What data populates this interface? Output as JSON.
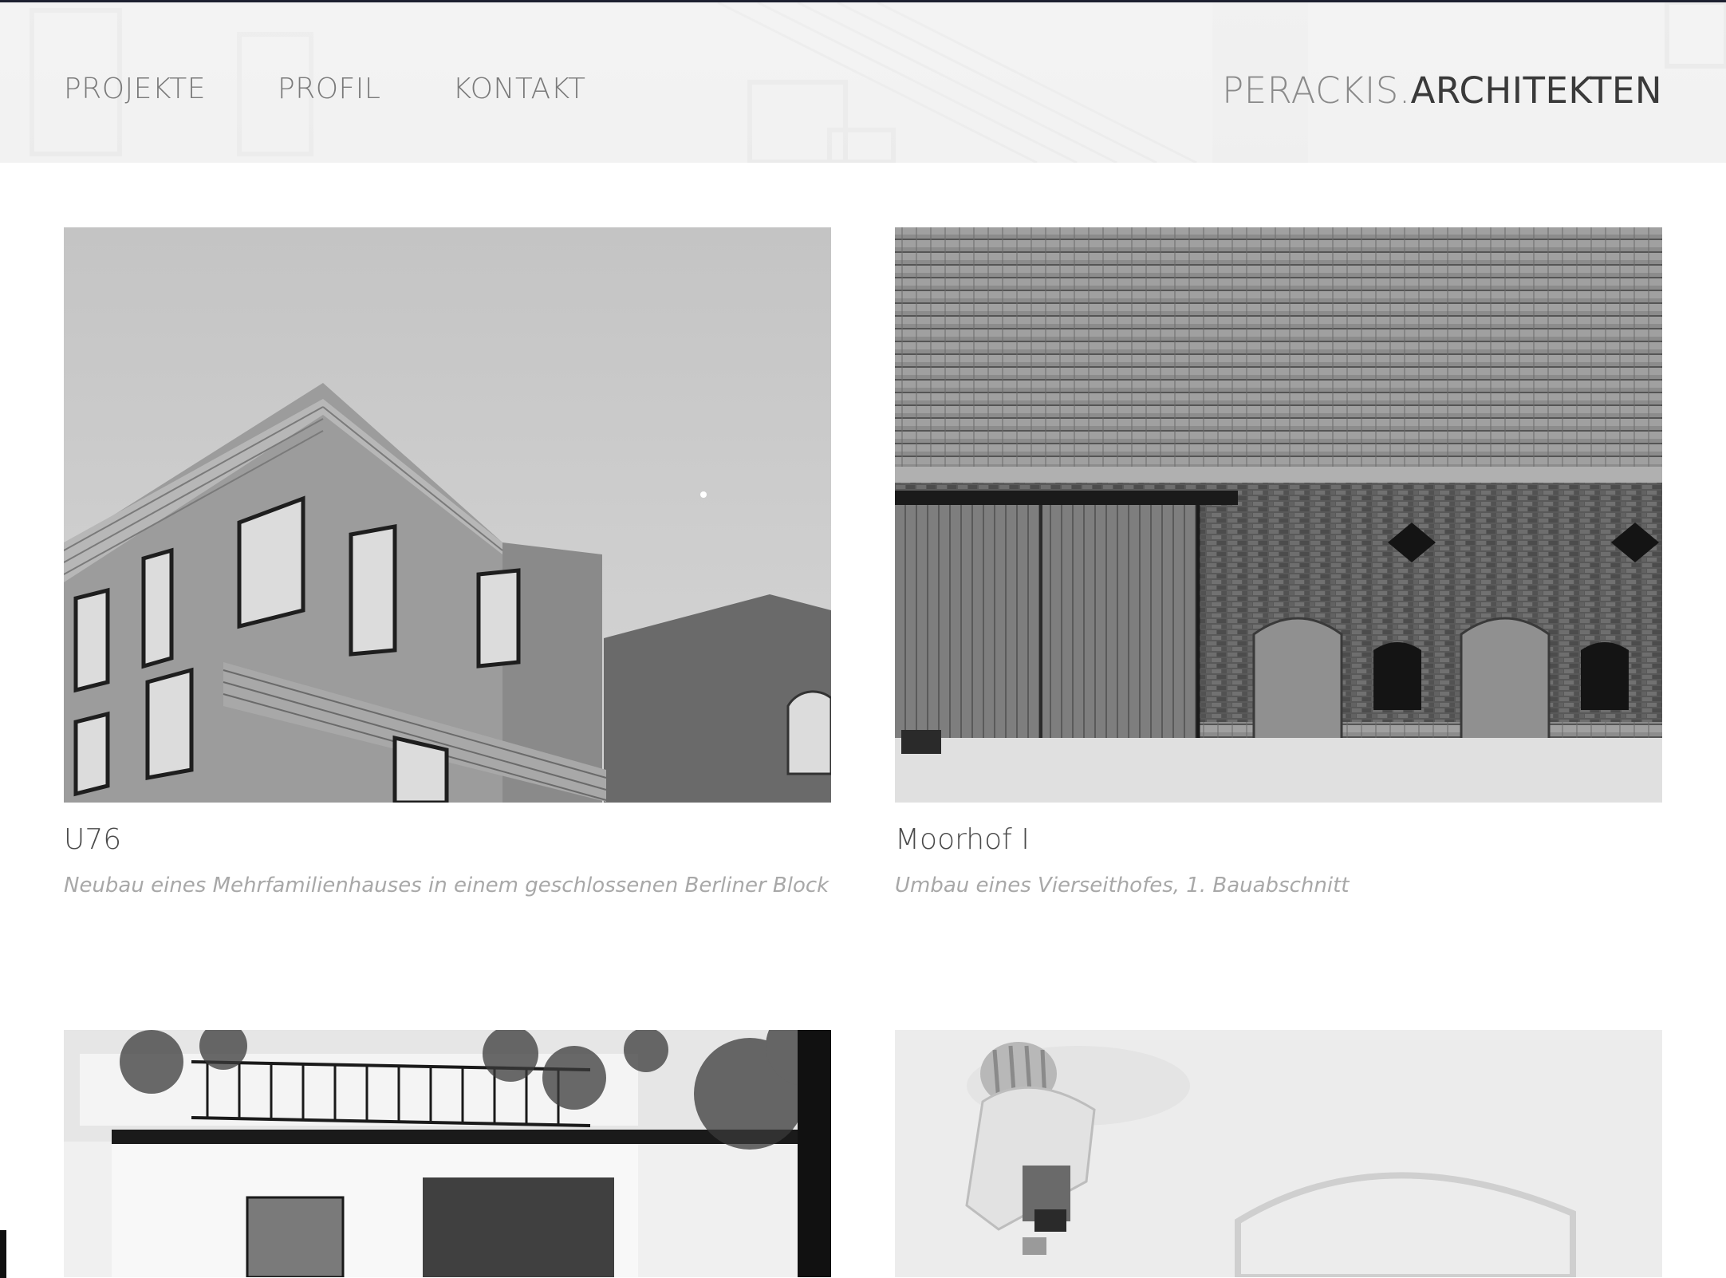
{
  "header": {
    "nav": [
      {
        "label": "PROJEKTE"
      },
      {
        "label": "PROFIL"
      },
      {
        "label": "KONTAKT"
      }
    ],
    "brand": {
      "light": "PERACKIS.",
      "dark": "ARCHITEKTEN"
    }
  },
  "projects": [
    {
      "title": "U76",
      "description": "Neubau eines Mehrfamilienhauses in einem geschlossenen Berliner Block"
    },
    {
      "title": "Moorhof I",
      "description": "Umbau eines Vierseithofes, 1. Bauabschnitt"
    },
    {
      "title": "",
      "description": ""
    },
    {
      "title": "",
      "description": ""
    }
  ],
  "colors": {
    "nav_text": "#7a7a7a",
    "brand_light": "#8a8a8a",
    "brand_dark": "#3a3a3a",
    "title_text": "#4a4a4a",
    "desc_text": "#a8a8a8"
  }
}
